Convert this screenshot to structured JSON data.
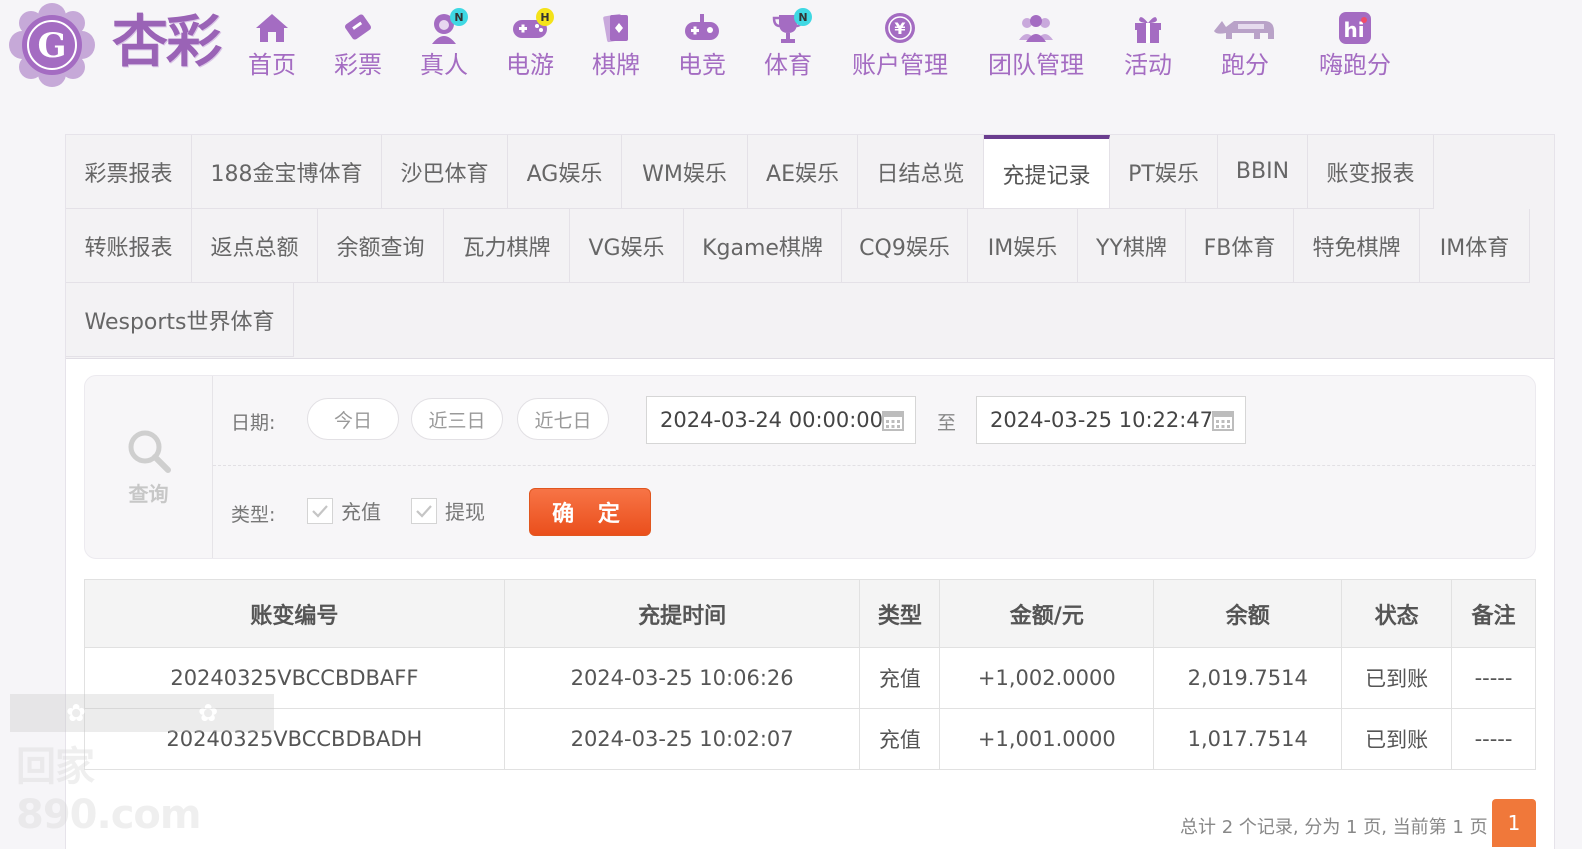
{
  "brand": {
    "name": "杏彩",
    "accent": "#9a63b6",
    "primary": "#6a3d8f"
  },
  "nav": [
    {
      "label": "首页",
      "icon": "home-icon"
    },
    {
      "label": "彩票",
      "icon": "lottery-ticket-icon"
    },
    {
      "label": "真人",
      "icon": "live-dealer-icon",
      "badge": "N"
    },
    {
      "label": "电游",
      "icon": "gamepad-icon",
      "badge": "H"
    },
    {
      "label": "棋牌",
      "icon": "playing-cards-icon"
    },
    {
      "label": "电竞",
      "icon": "esports-controller-icon"
    },
    {
      "label": "体育",
      "icon": "trophy-icon",
      "badge": "N"
    },
    {
      "label": "账户管理",
      "icon": "yen-coin-icon"
    },
    {
      "label": "团队管理",
      "icon": "team-icon"
    },
    {
      "label": "活动",
      "icon": "gift-icon"
    },
    {
      "label": "跑分",
      "icon": "rhino-icon"
    },
    {
      "label": "嗨跑分",
      "icon": "hi-app-icon"
    }
  ],
  "tabs": {
    "row1": [
      "彩票报表",
      "188金宝博体育",
      "沙巴体育",
      "AG娱乐",
      "WM娱乐",
      "AE娱乐",
      "日结总览",
      "充提记录",
      "PT娱乐",
      "BBIN",
      "账变报表"
    ],
    "row2": [
      "转账报表",
      "返点总额",
      "余额查询",
      "瓦力棋牌",
      "VG娱乐",
      "Kgame棋牌",
      "CQ9娱乐",
      "IM娱乐",
      "YY棋牌",
      "FB体育",
      "特免棋牌",
      "IM体育"
    ],
    "row3": [
      "Wesports世界体育"
    ],
    "active": "充提记录"
  },
  "query": {
    "side_label": "查询",
    "date_label": "日期:",
    "quick_ranges": [
      "今日",
      "近三日",
      "近七日"
    ],
    "start": "2024-03-24 00:00:00",
    "to_label": "至",
    "end": "2024-03-25 10:22:47",
    "type_label": "类型:",
    "types": [
      {
        "label": "充值",
        "checked": true
      },
      {
        "label": "提现",
        "checked": true
      }
    ],
    "confirm": "确 定"
  },
  "table": {
    "headers": [
      "账变编号",
      "充提时间",
      "类型",
      "金额/元",
      "余额",
      "状态",
      "备注"
    ],
    "rows": [
      {
        "id": "20240325VBCCBDBAFF",
        "time": "2024-03-25 10:06:26",
        "type": "充值",
        "amount": "+1,002.0000",
        "balance": "2,019.7514",
        "status": "已到账",
        "note": "-----"
      },
      {
        "id": "20240325VBCCBDBADH",
        "time": "2024-03-25 10:02:07",
        "type": "充值",
        "amount": "+1,001.0000",
        "balance": "1,017.7514",
        "status": "已到账",
        "note": "-----"
      }
    ]
  },
  "pagination": {
    "summary": "总计 2 个记录, 分为 1 页, 当前第 1 页",
    "current": "1"
  },
  "watermark": {
    "line2": "回家890.com"
  }
}
